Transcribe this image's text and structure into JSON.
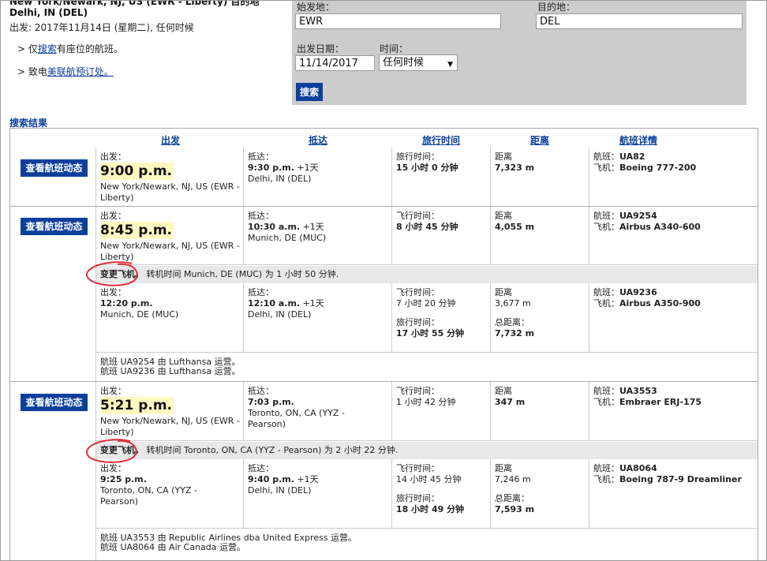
{
  "header": {
    "route": "New York/Newark, NJ, US (EWR - Liberty) 目的地",
    "destination": "Delhi, IN (DEL)",
    "depart_info": "出发: 2017年11月14日 (星期二), 任何时候",
    "tip1_prefix": "> 仅",
    "tip1_link": "搜索",
    "tip1_suffix": "有座位的航班。",
    "tip2_prefix": "> 致电",
    "tip2_link": "美联航预订处。"
  },
  "search": {
    "origin_label": "始发地：",
    "origin_value": "EWR",
    "dest_label": "目的地：",
    "dest_value": "DEL",
    "date_label": "出发日期：",
    "date_value": "11/14/2017",
    "time_label": "时间：",
    "time_value": "任何时候",
    "search_button": "搜索"
  },
  "results": {
    "title": "搜索结果",
    "columns": [
      "出发",
      "抵达",
      "旅行时间",
      "距离",
      "航班详情"
    ],
    "status_button": "查看航班动态",
    "groups": [
      {
        "segments": [
          {
            "dep_label": "出发：",
            "dep_time": "9:00 p.m.",
            "dep_place": "New York/Newark, NJ, US (EWR - Liberty)",
            "arr_label": "抵达：",
            "arr_time": "9:30 p.m.",
            "arr_next": " +1天",
            "arr_place": "Delhi, IN (DEL)",
            "time_label": "旅行时间：",
            "time_value": "15 小时 0 分钟",
            "dist_label": "距离",
            "dist_value": "7,323 m",
            "flight_label": "航班：",
            "flight_value": "UA82",
            "aircraft_label": "飞机：",
            "aircraft_value": "Boeing 777-200"
          }
        ]
      },
      {
        "segments": [
          {
            "dep_label": "出发：",
            "dep_time": "8:45 p.m.",
            "dep_place": "New York/Newark, NJ, US (EWR - Liberty)",
            "arr_label": "抵达：",
            "arr_time": "10:30 a.m.",
            "arr_next": " +1天",
            "arr_place": "Munich, DE (MUC)",
            "time_label": "飞行时间：",
            "time_value": "8 小时 45 分钟",
            "dist_label": "距离",
            "dist_value": "4,055 m",
            "flight_label": "航班：",
            "flight_value": "UA9254",
            "aircraft_label": "飞机：",
            "aircraft_value": "Airbus A340-600"
          },
          {
            "dep_label": "出发：",
            "dep_time": "12:20 p.m.",
            "dep_place": "Munich, DE (MUC)",
            "arr_label": "抵达：",
            "arr_time": "12:10 a.m.",
            "arr_next": " +1天",
            "arr_place": "Delhi, IN (DEL)",
            "time_label": "飞行时间：",
            "time_value": "7 小时 20 分钟",
            "total_time_label": "旅行时间：",
            "total_time_value": "17 小时 55 分钟",
            "dist_label": "距离",
            "dist_value": "3,677 m",
            "total_dist_label": "总距离：",
            "total_dist_value": "7,732 m",
            "flight_label": "航班：",
            "flight_value": "UA9236",
            "aircraft_label": "飞机：",
            "aircraft_value": "Airbus A350-900"
          }
        ],
        "connection": {
          "change": "变更飞机。",
          "text": " 转机时间 Munich, DE (MUC) 为 1 小时 50 分钟."
        },
        "operators": [
          "航班 UA9254 由 Lufthansa 运营。",
          "航班 UA9236 由 Lufthansa 运营。"
        ]
      },
      {
        "segments": [
          {
            "dep_label": "出发：",
            "dep_time": "5:21 p.m.",
            "dep_place": "New York/Newark, NJ, US (EWR - Liberty)",
            "arr_label": "抵达：",
            "arr_time": "7:03 p.m.",
            "arr_next": "",
            "arr_place": "Toronto, ON, CA (YYZ - Pearson)",
            "time_label": "飞行时间：",
            "time_value": "1 小时 42 分钟",
            "dist_label": "距离",
            "dist_value": "347 m",
            "flight_label": "航班：",
            "flight_value": "UA3553",
            "aircraft_label": "飞机：",
            "aircraft_value": "Embraer ERJ-175"
          },
          {
            "dep_label": "出发：",
            "dep_time": "9:25 p.m.",
            "dep_place": "Toronto, ON, CA (YYZ - Pearson)",
            "arr_label": "抵达：",
            "arr_time": "9:40 p.m.",
            "arr_next": " +1天",
            "arr_place": "Delhi, IN (DEL)",
            "time_label": "飞行时间：",
            "time_value": "14 小时 45 分钟",
            "total_time_label": "旅行时间：",
            "total_time_value": "18 小时 49 分钟",
            "dist_label": "距离",
            "dist_value": "7,246 m",
            "total_dist_label": "总距离：",
            "total_dist_value": "7,593 m",
            "flight_label": "航班：",
            "flight_value": "UA8064",
            "aircraft_label": "飞机：",
            "aircraft_value": "Boeing 787-9 Dreamliner"
          }
        ],
        "connection": {
          "change": "变更飞机。",
          "text": " 转机时间 Toronto, ON, CA (YYZ - Pearson) 为 2 小时 22 分钟."
        },
        "operators": [
          "航班 UA3553 由 Republic Airlines dba United Express 运营。",
          "航班 UA8064 由 Air Canada 运营。"
        ]
      }
    ]
  },
  "annotation_color": "#e0303a"
}
